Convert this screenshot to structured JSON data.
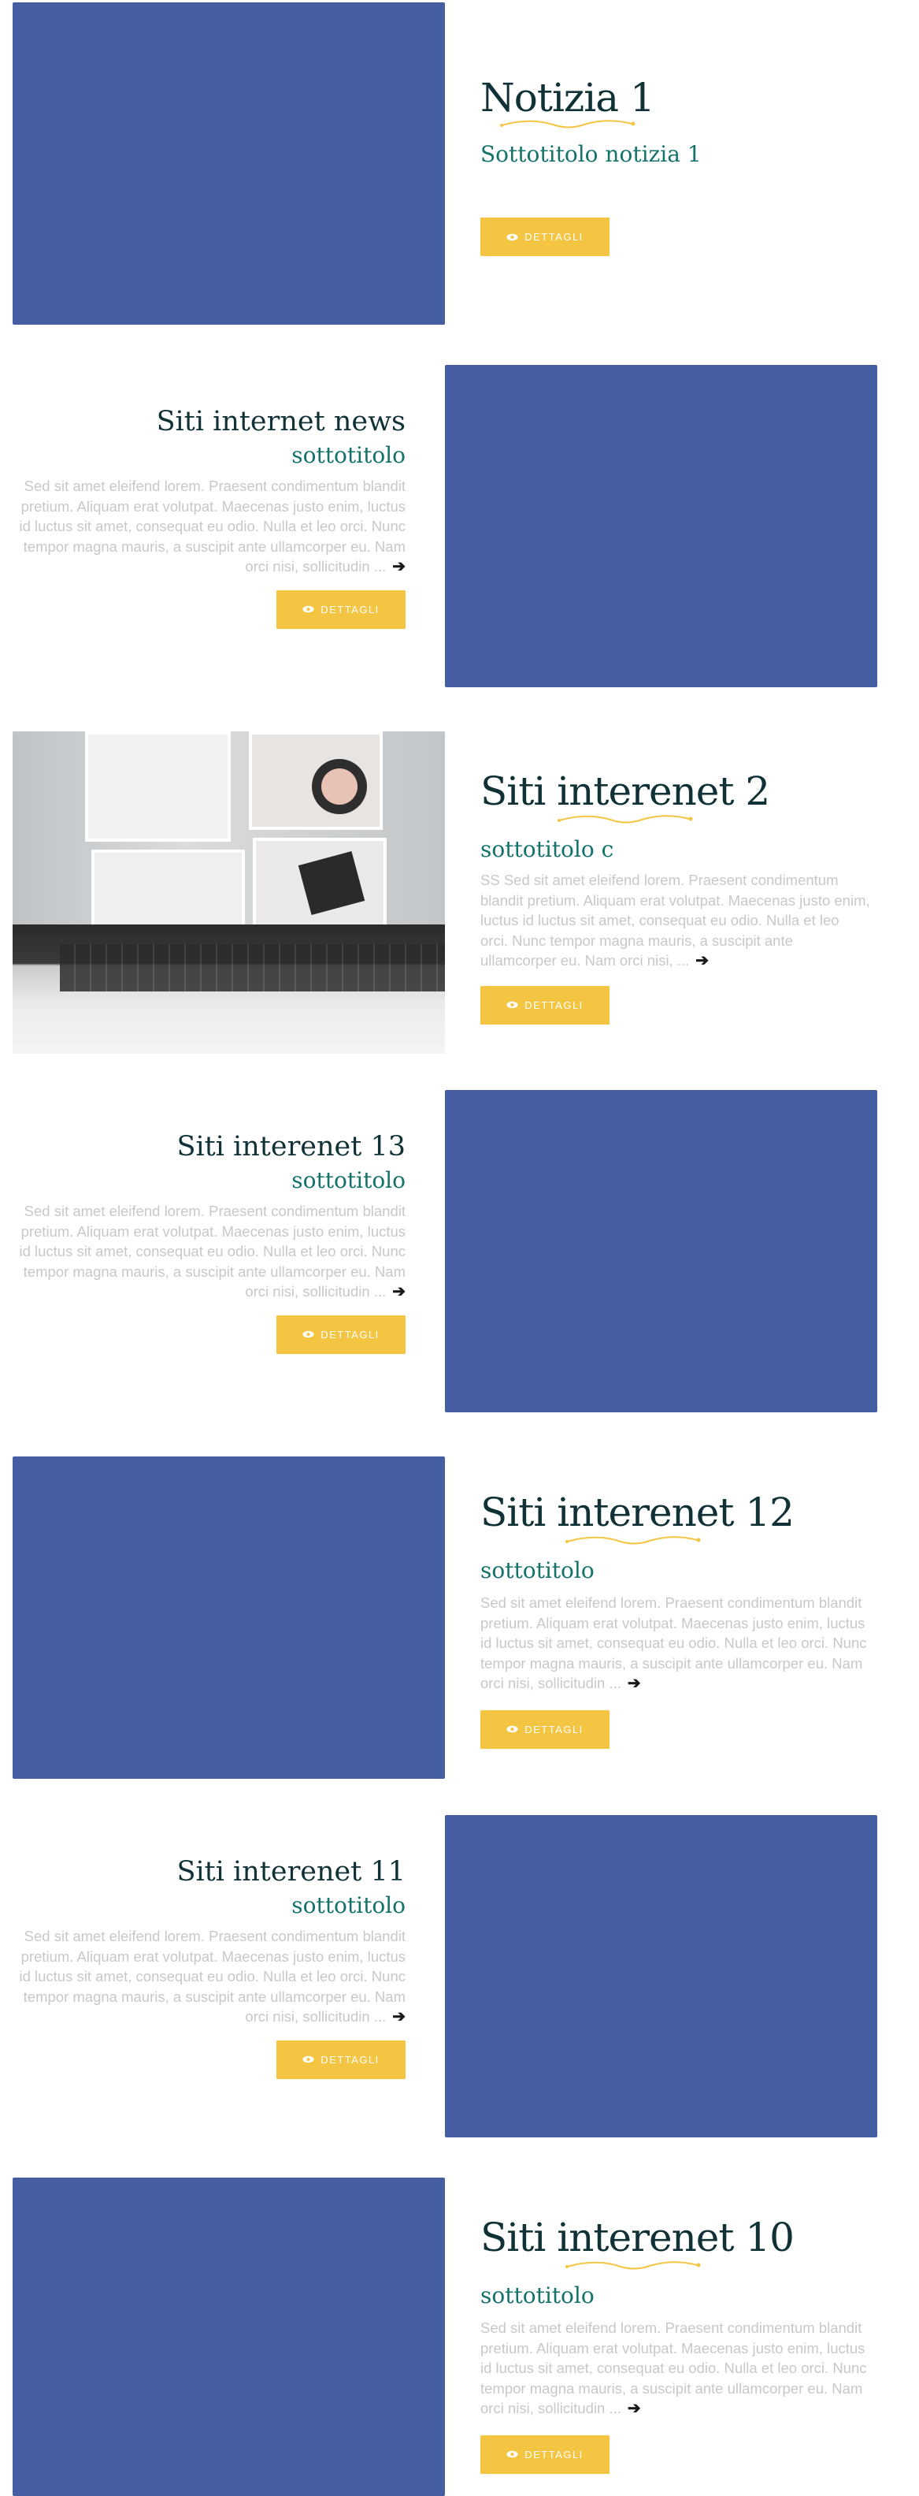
{
  "theme": {
    "accent": "#f4c542",
    "image_placeholder": "#455ea3",
    "title_color": "#103236",
    "subtitle_color": "#13736b"
  },
  "posts": [
    {
      "title": "Notizia 1",
      "subtitle": "Sottotitolo notizia 1",
      "excerpt": "",
      "button": "DETTAGLI"
    },
    {
      "title": "Siti internet news",
      "subtitle": "sottotitolo",
      "excerpt": "Sed sit amet eleifend lorem. Praesent condimentum blandit pretium. Aliquam erat volutpat. Maecenas justo enim, luctus id luctus sit amet, consequat eu odio. Nulla et leo orci. Nunc tempor magna mauris, a suscipit ante ullamcorper eu. Nam orci nisi, sollicitudin ...",
      "button": "DETTAGLI"
    },
    {
      "title": "Siti interenet 2",
      "subtitle": "sottotitolo c",
      "excerpt": "SS Sed sit amet eleifend lorem. Praesent condimentum blandit pretium. Aliquam erat volutpat. Maecenas justo enim, luctus id luctus sit amet, consequat eu odio. Nulla et leo orci. Nunc tempor magna mauris, a suscipit ante ullamcorper eu. Nam orci nisi, ...",
      "button": "DETTAGLI"
    },
    {
      "title": "Siti interenet 13",
      "subtitle": "sottotitolo",
      "excerpt": "Sed sit amet eleifend lorem. Praesent condimentum blandit pretium. Aliquam erat volutpat. Maecenas justo enim, luctus id luctus sit amet, consequat eu odio. Nulla et leo orci. Nunc tempor magna mauris, a suscipit ante ullamcorper eu. Nam orci nisi, sollicitudin ...",
      "button": "DETTAGLI"
    },
    {
      "title": "Siti interenet 12",
      "subtitle": "sottotitolo",
      "excerpt": "Sed sit amet eleifend lorem. Praesent condimentum blandit pretium. Aliquam erat volutpat. Maecenas justo enim, luctus id luctus sit amet, consequat eu odio. Nulla et leo orci. Nunc tempor magna mauris, a suscipit ante ullamcorper eu. Nam orci nisi, sollicitudin ...",
      "button": "DETTAGLI"
    },
    {
      "title": "Siti interenet 11",
      "subtitle": "sottotitolo",
      "excerpt": "Sed sit amet eleifend lorem. Praesent condimentum blandit pretium. Aliquam erat volutpat. Maecenas justo enim, luctus id luctus sit amet, consequat eu odio. Nulla et leo orci. Nunc tempor magna mauris, a suscipit ante ullamcorper eu. Nam orci nisi, sollicitudin ...",
      "button": "DETTAGLI"
    },
    {
      "title": "Siti interenet 10",
      "subtitle": "sottotitolo",
      "excerpt": "Sed sit amet eleifend lorem. Praesent condimentum blandit pretium. Aliquam erat volutpat. Maecenas justo enim, luctus id luctus sit amet, consequat eu odio. Nulla et leo orci. Nunc tempor magna mauris, a suscipit ante ullamcorper eu. Nam orci nisi, sollicitudin ...",
      "button": "DETTAGLI"
    }
  ],
  "icons": {
    "button": "eye-icon",
    "read_more": "arrow-right-icon",
    "divider": "swirl-ornament-icon"
  }
}
